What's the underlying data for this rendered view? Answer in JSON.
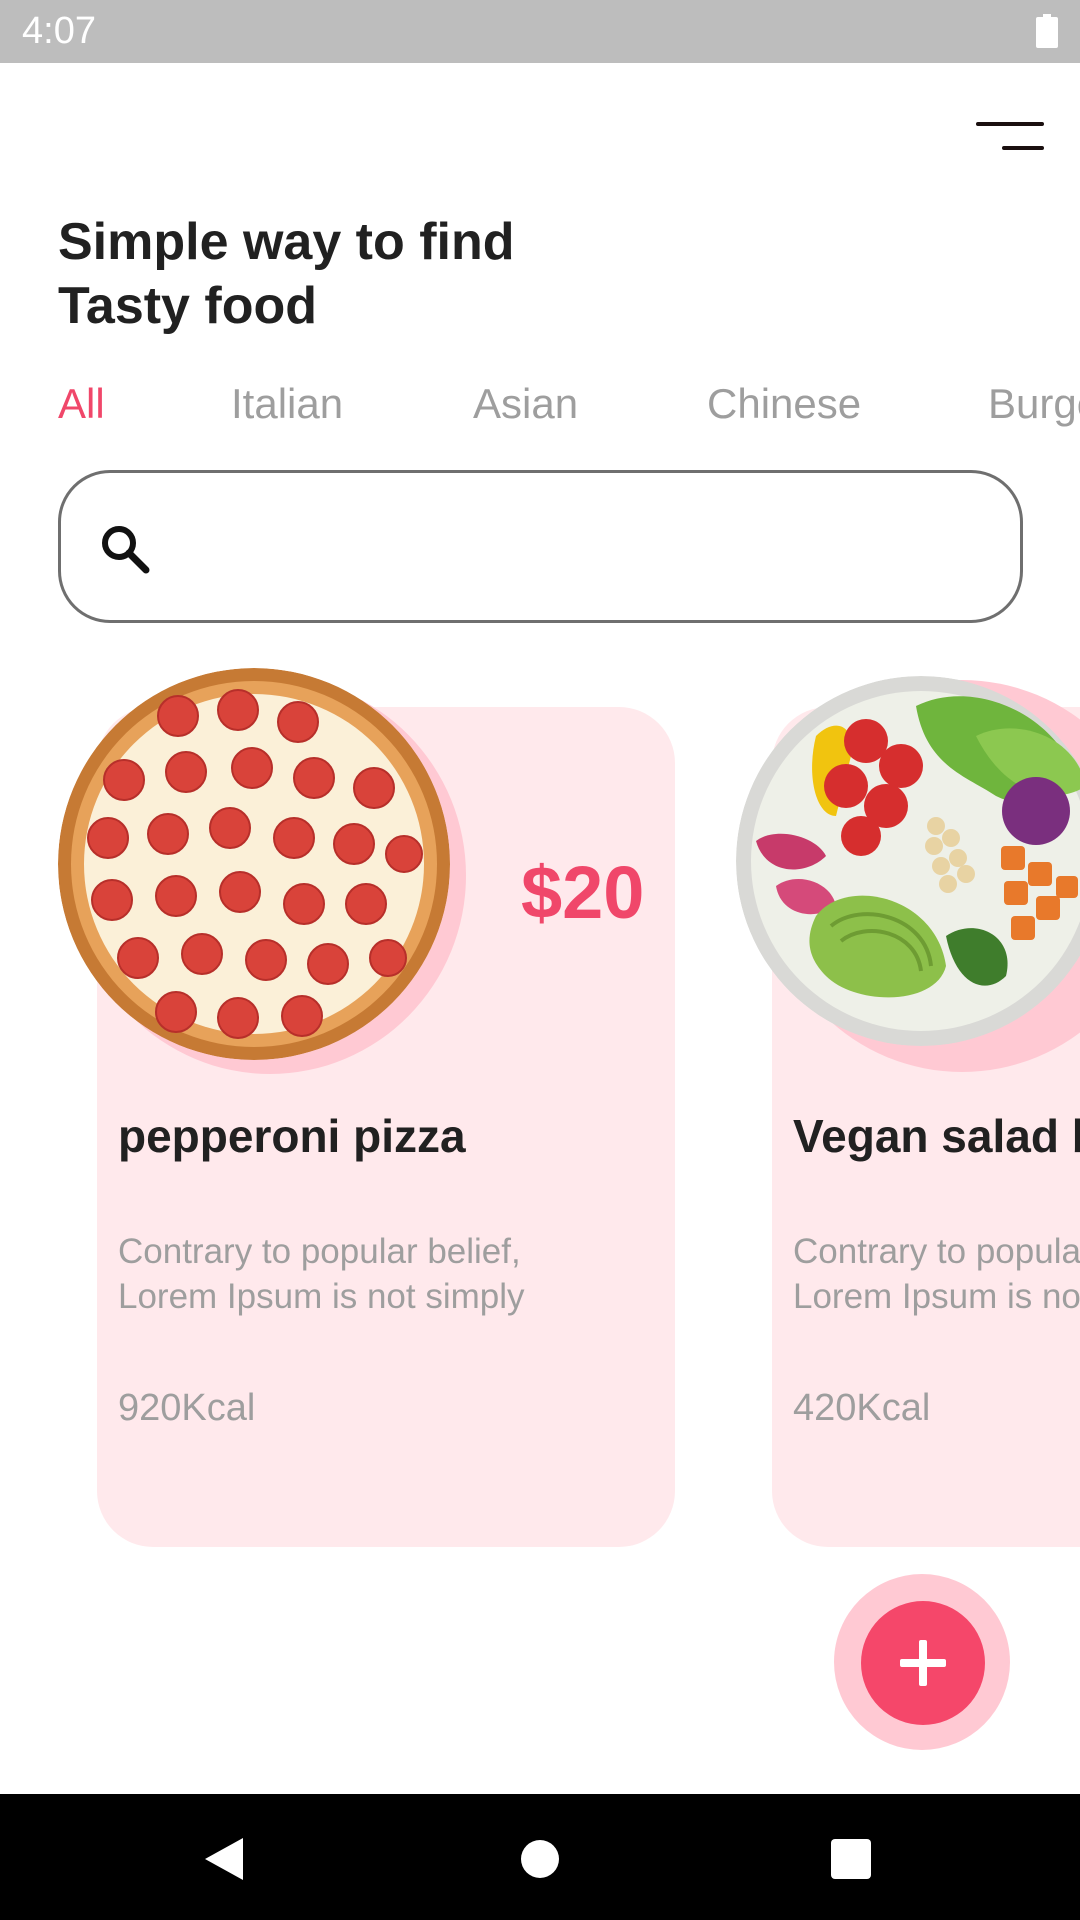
{
  "status_bar": {
    "time": "4:07",
    "battery_icon": "battery-icon"
  },
  "header": {
    "menu_icon": "menu-icon"
  },
  "title": {
    "line1": "Simple way to find",
    "line2": "Tasty food"
  },
  "categories": {
    "active": "All",
    "items": [
      "All",
      "Italian",
      "Asian",
      "Chinese",
      "Burgers"
    ]
  },
  "search": {
    "icon": "search-icon",
    "value": "",
    "placeholder": ""
  },
  "cards": [
    {
      "name": "pepperoni pizza",
      "price": "$20",
      "description_line1": "Contrary to popular belief,",
      "description_line2": "Lorem Ipsum is not simply",
      "calories": "920Kcal",
      "image": "pizza-image"
    },
    {
      "name": "Vegan salad bowl",
      "price": "",
      "description_line1": "Contrary to popular belief,",
      "description_line2": "Lorem Ipsum is not simply",
      "calories": "420Kcal",
      "image": "salad-image"
    }
  ],
  "fab": {
    "icon": "plus-icon"
  },
  "nav_bar": {
    "back": "back-icon",
    "home": "home-icon",
    "recents": "recents-icon"
  },
  "colors": {
    "accent": "#f0476a",
    "card_background": "#ffe9ec",
    "image_halo": "#ffc9d3",
    "status_bar": "#bdbdbd",
    "muted_text": "#9e9e9e",
    "title_text": "#212121"
  }
}
